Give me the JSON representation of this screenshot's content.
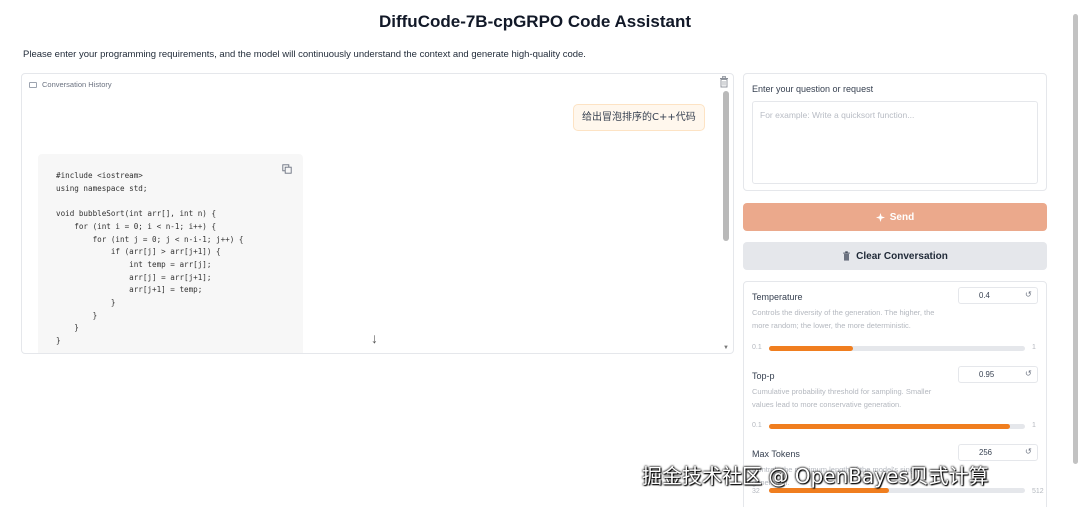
{
  "header": {
    "title": "DiffuCode-7B-cpGRPO Code Assistant",
    "subtitle": "Please enter your programming requirements, and the model will continuously understand the context and generate high-quality code."
  },
  "chat": {
    "label": "Conversation History",
    "user_message": "给出冒泡排序的C++代码",
    "code_lines": [
      "#include <iostream>",
      "using namespace std;",
      "",
      "void bubbleSort(int arr[], int n) {",
      "    for (int i = 0; i < n-1; i++) {",
      "        for (int j = 0; j < n-i-1; j++) {",
      "            if (arr[j] > arr[j+1]) {",
      "                int temp = arr[j];",
      "                arr[j] = arr[j+1];",
      "                arr[j+1] = temp;",
      "            }",
      "        }",
      "    }",
      "}"
    ],
    "scroll_down_glyph": "↓"
  },
  "input": {
    "label": "Enter your question or request",
    "placeholder": "For example: Write a quicksort function...",
    "value": ""
  },
  "buttons": {
    "send_label": "Send",
    "clear_label": "Clear Conversation"
  },
  "params": {
    "temperature": {
      "title": "Temperature",
      "description": "Controls the diversity of the generation. The higher, the more random; the lower, the more deterministic.",
      "value": "0.4",
      "min": "0.1",
      "max": "1",
      "fill_fraction": 0.33
    },
    "top_p": {
      "title": "Top-p",
      "description": "Cumulative probability threshold for sampling. Smaller values lead to more conservative generation.",
      "value": "0.95",
      "min": "0.1",
      "max": "1",
      "fill_fraction": 0.94
    },
    "max_tokens": {
      "title": "Max Tokens",
      "description": "Controls the maximum length of the model's single generation.",
      "value": "256",
      "min": "32",
      "max": "512",
      "fill_fraction": 0.47
    }
  },
  "watermark": "掘金技术社区 @ OpenBayes贝式计算",
  "colors": {
    "accent_orange": "#f07e1f",
    "send_button": "#eba98c",
    "clear_button": "#e5e7eb",
    "user_bubble": "#fff7ed"
  }
}
